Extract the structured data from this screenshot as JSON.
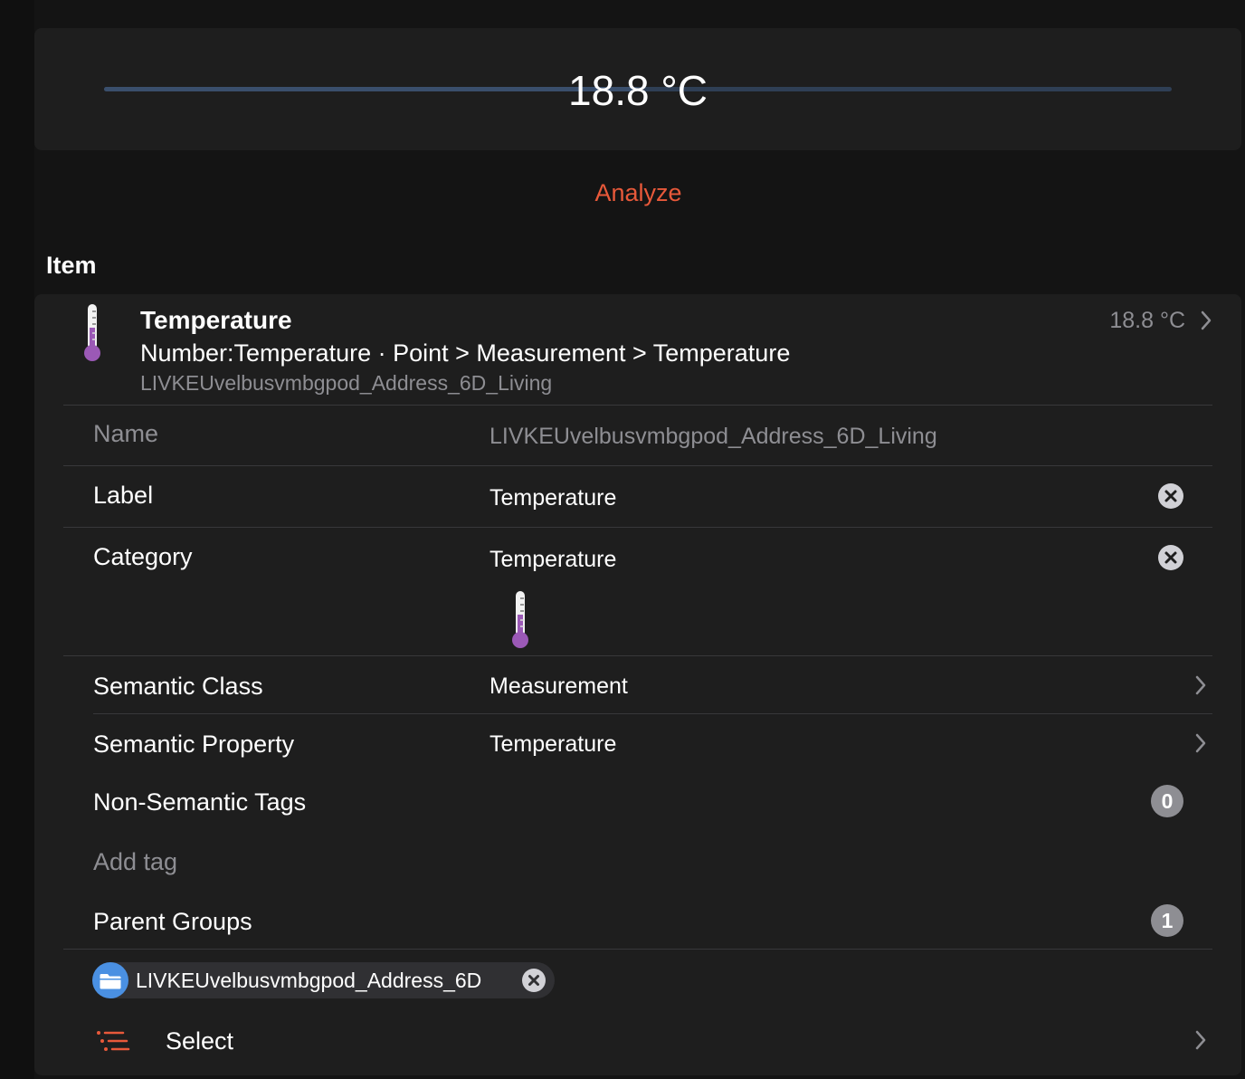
{
  "slider": {
    "value_text": "18.8 °C",
    "position": 0.5,
    "track_color": "#2f3f55"
  },
  "analyze_label": "Analyze",
  "section_title": "Item",
  "item": {
    "icon": "thermometer-icon",
    "title": "Temperature",
    "subtitle": "Number:Temperature · Point > Measurement > Temperature",
    "name": "LIVKEUvelbusvmbgpod_Address_6D_Living",
    "state": "18.8 °C"
  },
  "rows": {
    "name": {
      "label": "Name",
      "value": "LIVKEUvelbusvmbgpod_Address_6D_Living"
    },
    "label": {
      "label": "Label",
      "value": "Temperature"
    },
    "category": {
      "label": "Category",
      "value": "Temperature",
      "icon": "thermometer-icon"
    },
    "semantic_class": {
      "label": "Semantic Class",
      "value": "Measurement"
    },
    "semantic_property": {
      "label": "Semantic Property",
      "value": "Temperature"
    },
    "non_semantic_tags": {
      "label": "Non-Semantic Tags",
      "count": "0"
    },
    "add_tag": {
      "placeholder": "Add tag"
    },
    "parent_groups": {
      "label": "Parent Groups",
      "count": "1"
    }
  },
  "parent_group_chip": {
    "label": "LIVKEUvelbusvmbgpod_Address_6D",
    "icon": "folder-icon"
  },
  "select": {
    "label": "Select",
    "icon": "list-icon"
  },
  "colors": {
    "accent": "#e8593a",
    "thermometer_fill": "#9b59b6",
    "folder_blue": "#4a90e2",
    "badge_gray": "#8e8e93"
  }
}
